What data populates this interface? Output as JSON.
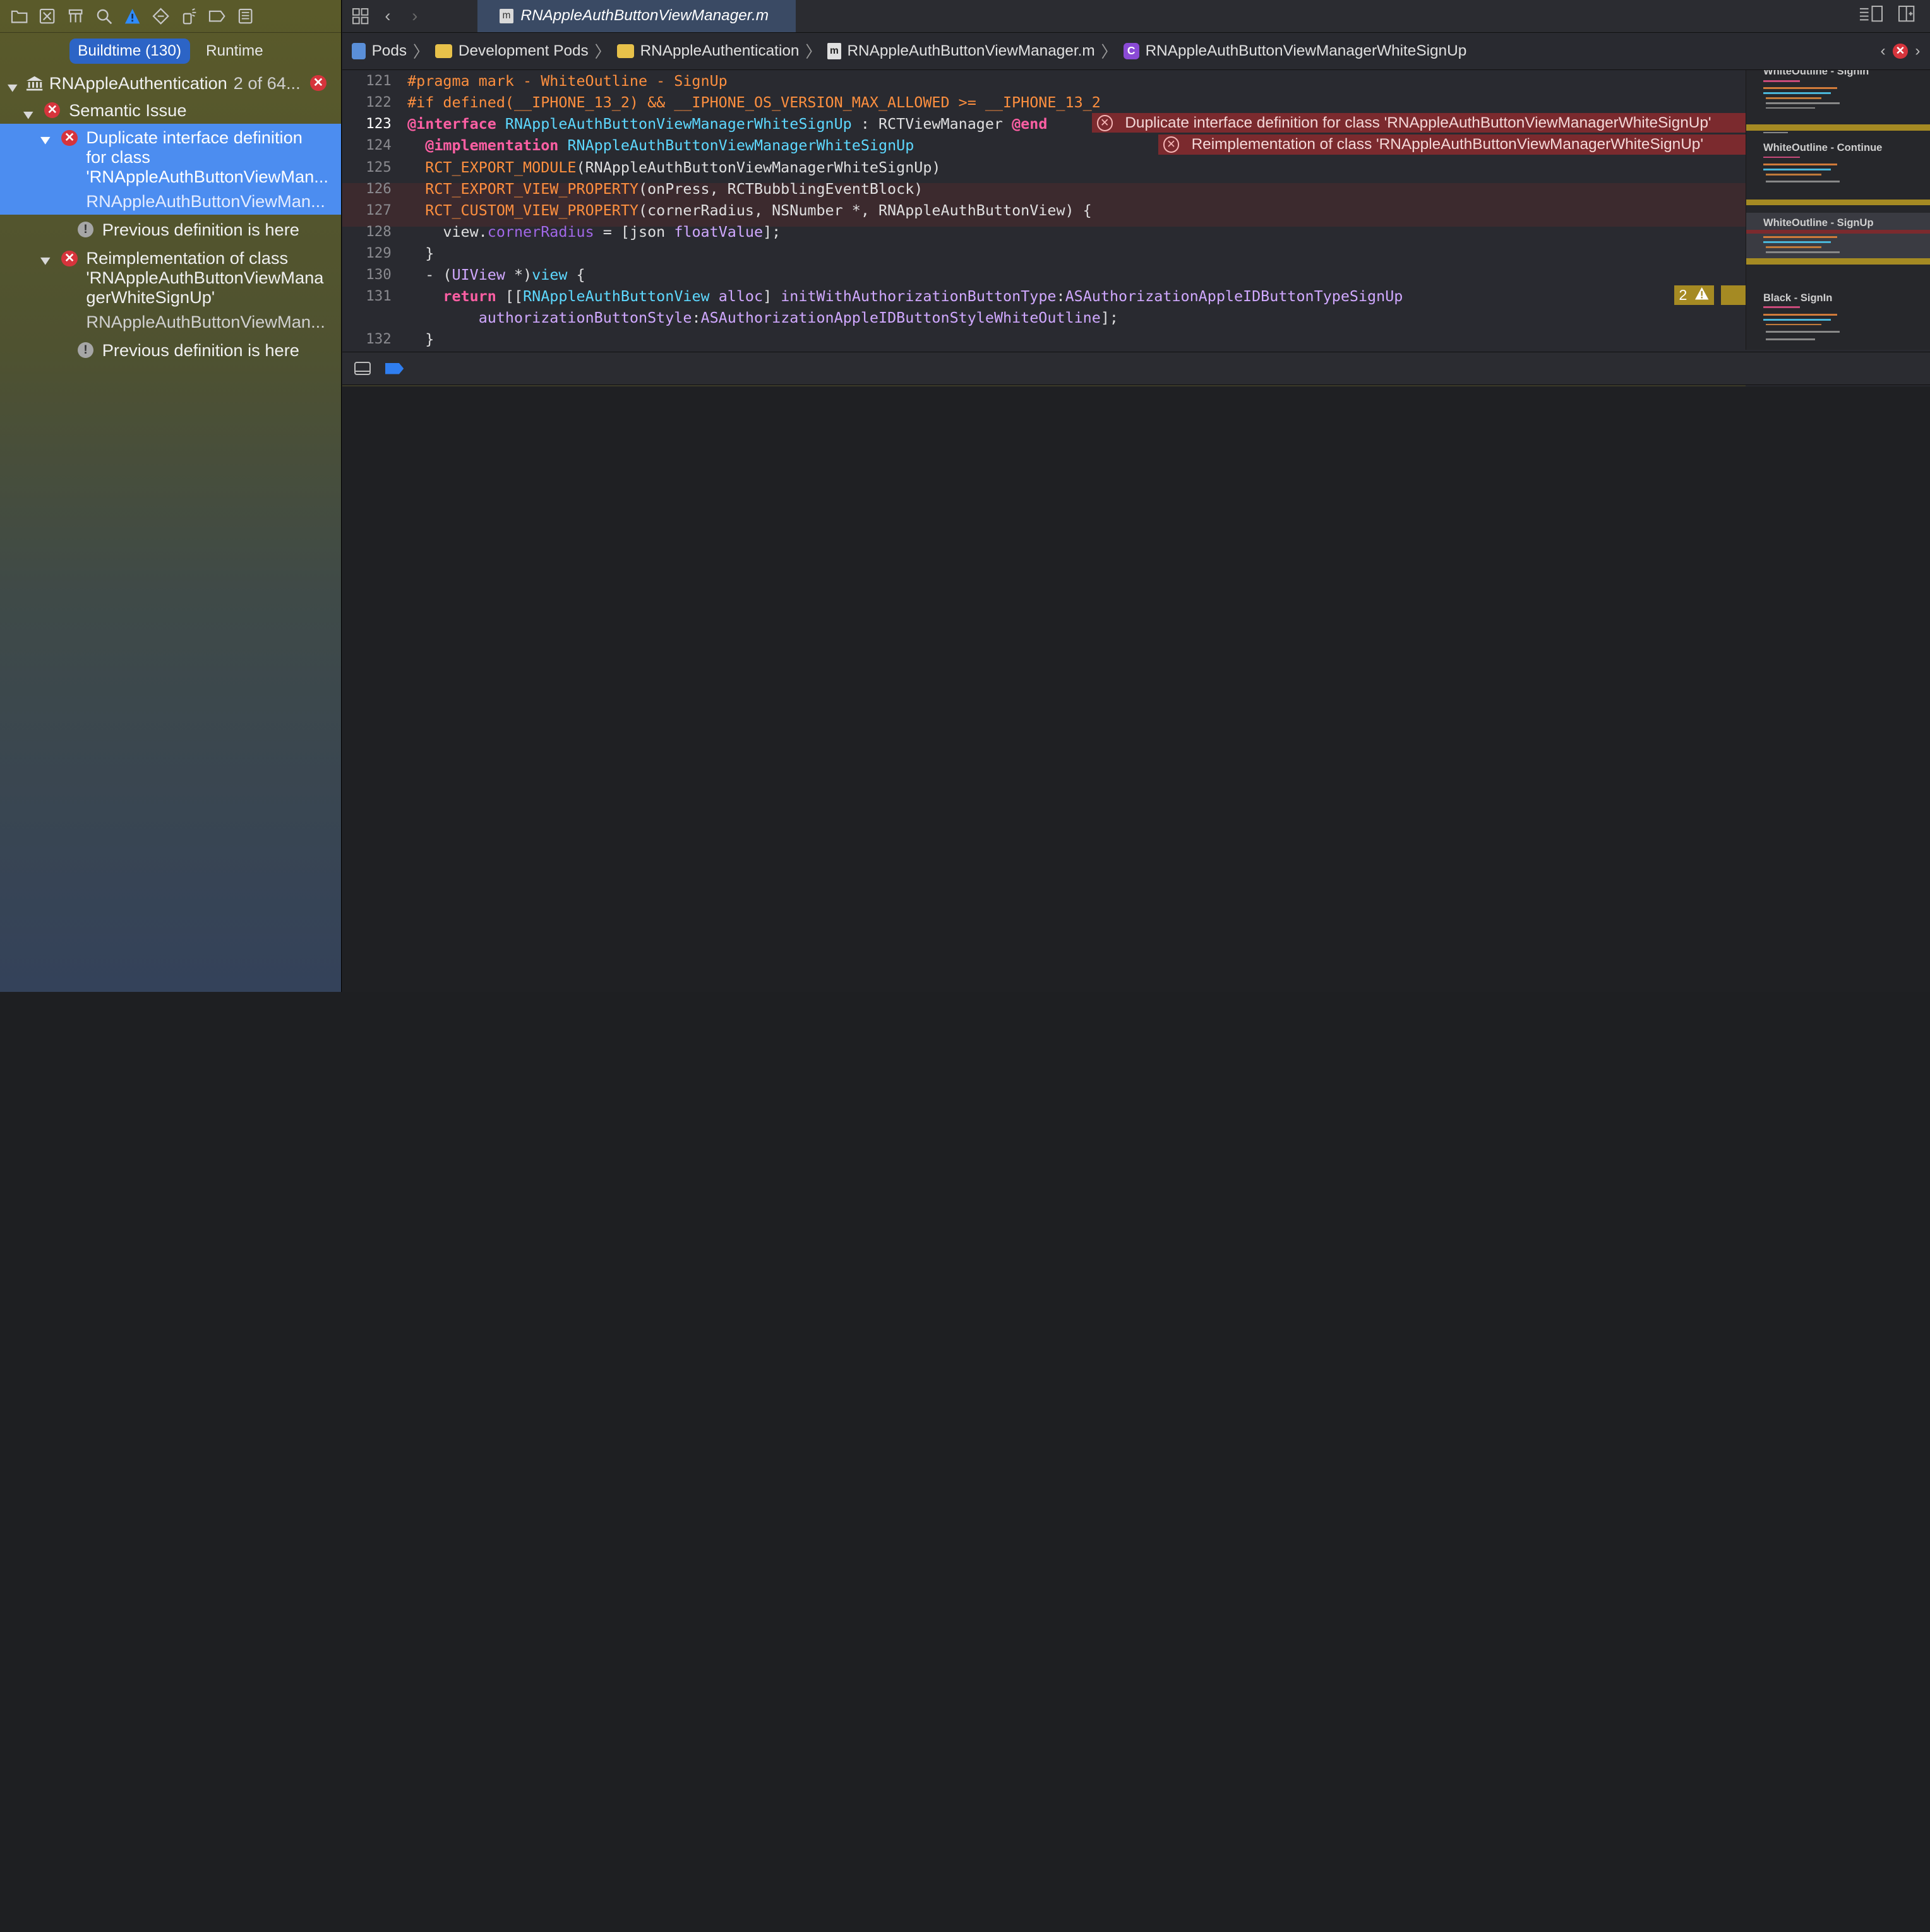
{
  "navigator": {
    "scope_buildtime": "Buildtime (130)",
    "scope_runtime": "Runtime",
    "project": {
      "name": "RNAppleAuthentication",
      "count": "2 of 64..."
    },
    "group": "Semantic Issue",
    "issues": [
      {
        "title_l1": "Duplicate interface definition",
        "title_l2": "for class",
        "title_l3": "'RNAppleAuthButtonViewMan...",
        "file": "RNAppleAuthButtonViewMan...",
        "note": "Previous definition is here"
      },
      {
        "title_l1": "Reimplementation of class",
        "title_l2": "'RNAppleAuthButtonViewMana",
        "title_l3": "gerWhiteSignUp'",
        "file": "RNAppleAuthButtonViewMan...",
        "note": "Previous definition is here"
      }
    ]
  },
  "editor": {
    "tab_title": "RNAppleAuthButtonViewManager.m",
    "breadcrumb": [
      "Pods",
      "Development Pods",
      "RNAppleAuthentication",
      "RNAppleAuthButtonViewManager.m",
      "RNAppleAuthButtonViewManagerWhiteSignUp"
    ],
    "line_numbers": [
      "121",
      "122",
      "123",
      "124",
      "125",
      "126",
      "127",
      "128",
      "129",
      "130",
      "131",
      "132"
    ],
    "errors": [
      "Duplicate interface definition for class 'RNAppleAuthButtonViewManagerWhiteSignUp'",
      "Reimplementation of class 'RNAppleAuthButtonViewManagerWhiteSignUp'"
    ],
    "warning_count": "2",
    "code": {
      "l121": "#pragma mark - WhiteOutline - SignUp",
      "l122": "#if defined(__IPHONE_13_2) && __IPHONE_OS_VERSION_MAX_ALLOWED >= __IPHONE_13_2",
      "l123_kw": "@interface",
      "l123_cls": "RNAppleAuthButtonViewManagerWhiteSignUp",
      "l123_rest": " : RCTViewManager ",
      "l123_end": "@end",
      "l124_kw": "@implementation",
      "l124_cls": "RNAppleAuthButtonViewManagerWhiteSignUp",
      "l125_mac": "RCT_EXPORT_MODULE",
      "l125_rest": "(RNAppleAuthButtonViewManagerWhiteSignUp)",
      "l126_mac": "RCT_EXPORT_VIEW_PROPERTY",
      "l126_rest": "(onPress, RCTBubblingEventBlock)",
      "l127_mac": "RCT_CUSTOM_VIEW_PROPERTY",
      "l127_rest": "(cornerRadius, NSNumber *, RNAppleAuthButtonView) {",
      "l128_a": "view.",
      "l128_prop": "cornerRadius",
      "l128_b": " = [json ",
      "l128_m": "floatValue",
      "l128_c": "];",
      "l129": "}",
      "l130_a": "- (",
      "l130_t": "UIView",
      "l130_b": " *)",
      "l130_m": "view",
      "l130_c": " {",
      "l131_kw": "return",
      "l131_a": " [[",
      "l131_cls": "RNAppleAuthButtonView",
      "l131_m1": " alloc",
      "l131_b": "] ",
      "l131_m2": "initWithAuthorizationButtonType",
      "l131_c": ":",
      "l131_v1": "ASAuthorizationAppleIDButtonTypeSignUp",
      "l131b_m": "authorizationButtonStyle",
      "l131b_c": ":",
      "l131b_v": "ASAuthorizationAppleIDButtonStyleWhiteOutline",
      "l131b_d": "];",
      "l132": "}"
    }
  },
  "minimap": {
    "labels": [
      "WhiteOutline - SignIn",
      "WhiteOutline - Continue",
      "WhiteOutline - SignUp",
      "Black - SignIn"
    ]
  },
  "colors": {
    "selection": "#4c8df0",
    "error": "#d6343c",
    "warning": "#a58a23",
    "keyword": "#fc5fa3",
    "preprocessor": "#fd8f3f"
  }
}
